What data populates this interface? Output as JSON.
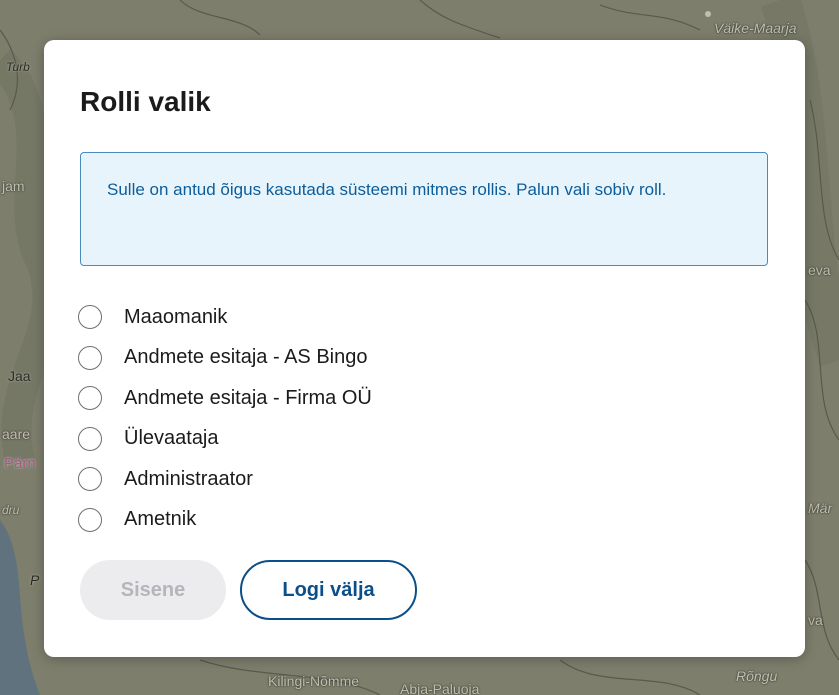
{
  "map": {
    "place_labels": [
      "Väike-Maarja",
      "Turb",
      "jam",
      "eva",
      "Jaa",
      "aare",
      "Pärn",
      "dru",
      "Mär",
      "P",
      "va",
      "Kilingi-Nõmme",
      "Abja-Paluoja",
      "Rõngu"
    ]
  },
  "dialog": {
    "title": "Rolli valik",
    "info_message": "Sulle on antud õigus kasutada süsteemi mitmes rollis. Palun vali sobiv roll.",
    "roles": [
      {
        "label": "Maaomanik",
        "selected": false
      },
      {
        "label": "Andmete esitaja - AS Bingo",
        "selected": false
      },
      {
        "label": "Andmete esitaja - Firma OÜ",
        "selected": false
      },
      {
        "label": "Ülevaataja",
        "selected": false
      },
      {
        "label": "Administraator",
        "selected": false
      },
      {
        "label": "Ametnik",
        "selected": false
      }
    ],
    "buttons": {
      "enter_label": "Sisene",
      "enter_disabled": true,
      "logout_label": "Logi välja"
    }
  },
  "colors": {
    "info_background": "#e8f4fb",
    "info_border": "#4a8ac0",
    "info_text": "#0b5d9c",
    "primary": "#0b4f8a",
    "disabled_background": "#ececee",
    "disabled_text": "#b5b6bb"
  }
}
